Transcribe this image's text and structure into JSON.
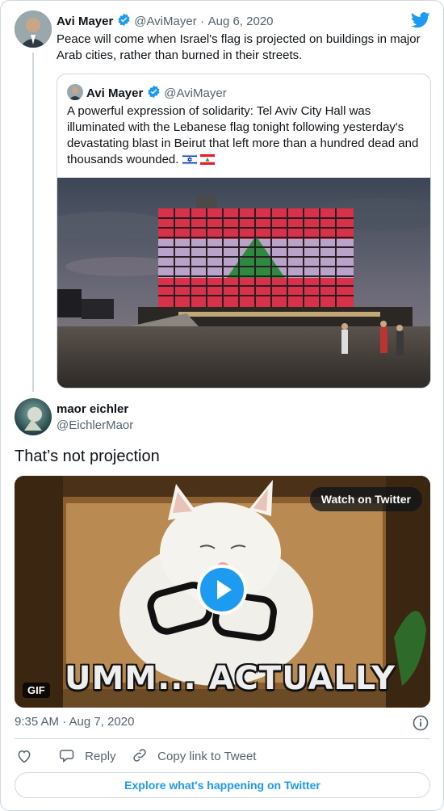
{
  "tweet": {
    "author_name": "Avi Mayer",
    "author_handle": "@AviMayer",
    "date": "Aug 6, 2020",
    "text": "Peace will come when Israel's flag is projected on buildings in major Arab cities, rather than burned in their streets."
  },
  "quoted": {
    "author_name": "Avi Mayer",
    "author_handle": "@AviMayer",
    "text": "A powerful expression of solidarity: Tel Aviv City Hall was illuminated with the Lebanese flag tonight following yesterday's devastating blast in Beirut that left more than a hundred dead and thousands wounded."
  },
  "reply": {
    "author_name": "maor eichler",
    "author_handle": "@EichlerMaor",
    "text": "That’s not projection",
    "media": {
      "watch_label": "Watch on Twitter",
      "gif_label": "GIF",
      "caption": "UMM... ACTUALLY"
    },
    "timestamp": "9:35 AM · Aug 7, 2020"
  },
  "actions": {
    "reply_label": "Reply",
    "copy_label": "Copy link to Tweet"
  },
  "explore_label": "Explore what's happening on Twitter",
  "colors": {
    "accent": "#1d9bf0",
    "verified": "#1d9bf0",
    "muted_text": "#536471",
    "border": "#cfd9de"
  },
  "icons": [
    "twitter-bird-icon",
    "verified-badge-icon",
    "info-icon",
    "heart-icon",
    "reply-icon",
    "link-icon",
    "play-icon"
  ]
}
